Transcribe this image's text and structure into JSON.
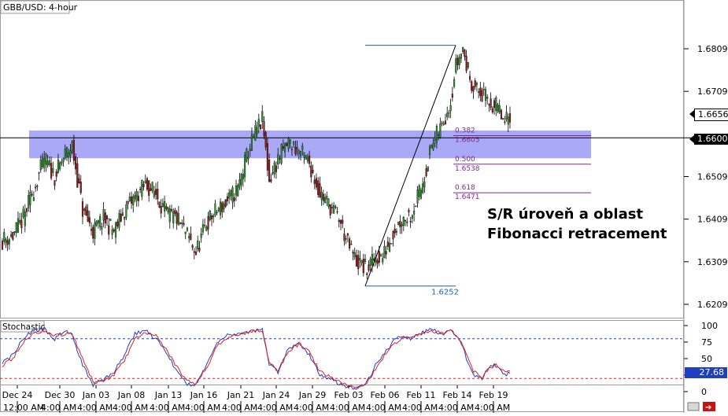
{
  "window_title": "GBB/USD: 4-hour",
  "indicator_title": "Stochastic",
  "colors": {
    "candle_up": "#2e8b2e",
    "candle_down": "#8b1a1a",
    "zone_fill": "#8c8cf5",
    "fib_line": "#7a2a8a",
    "fib_text": "#7a2a8a",
    "swing_line": "#1f5fbf",
    "stoch_k": "#1f3fbf",
    "stoch_d": "#e02020",
    "stoch_level_high": "#1f3fbf",
    "stoch_level_low": "#e02020",
    "current_price_bg": "#000000",
    "last_price_bg": "#ffffff",
    "stoch_badge_bg": "#1f3fbf"
  },
  "annotation": {
    "line1": "S/R úroveň a oblast",
    "line2": "Fibonacci retracement"
  },
  "chart_data": [
    {
      "type": "candlestick",
      "title": "GBB/USD: 4-hour",
      "ylim": [
        1.6185,
        1.6905
      ],
      "y_ticks": [
        "1.6809",
        "1.6709",
        "1.6509",
        "1.6409",
        "1.6309",
        "1.6209"
      ],
      "y_tick_values": [
        1.6809,
        1.6709,
        1.6509,
        1.6409,
        1.6309,
        1.6209
      ],
      "last_price": "1.6656",
      "current_level_label": "1.6600",
      "sr_level": 1.66,
      "sr_zone": [
        1.6552,
        1.6617
      ],
      "swing_low_label": "1.6252",
      "swing_low": 1.6252,
      "swing_high": 1.6817,
      "fibonacci": [
        {
          "ratio": "0.382",
          "price": "1.6605",
          "value": 1.6605
        },
        {
          "ratio": "0.500",
          "price": "1.6538",
          "value": 1.6538
        },
        {
          "ratio": "0.618",
          "price": "1.6471",
          "value": 1.6471
        }
      ],
      "close_path": [
        [
          0,
          1.636
        ],
        [
          6,
          1.637
        ],
        [
          12,
          1.641
        ],
        [
          18,
          1.648
        ],
        [
          24,
          1.655
        ],
        [
          30,
          1.651
        ],
        [
          36,
          1.656
        ],
        [
          40,
          1.658
        ],
        [
          46,
          1.643
        ],
        [
          52,
          1.638
        ],
        [
          58,
          1.641
        ],
        [
          64,
          1.638
        ],
        [
          70,
          1.643
        ],
        [
          76,
          1.646
        ],
        [
          82,
          1.649
        ],
        [
          88,
          1.647
        ],
        [
          94,
          1.642
        ],
        [
          100,
          1.641
        ],
        [
          106,
          1.637
        ],
        [
          111,
          1.633
        ],
        [
          117,
          1.64
        ],
        [
          123,
          1.643
        ],
        [
          129,
          1.645
        ],
        [
          135,
          1.648
        ],
        [
          141,
          1.657
        ],
        [
          146,
          1.662
        ],
        [
          149,
          1.664
        ],
        [
          153,
          1.65
        ],
        [
          158,
          1.655
        ],
        [
          164,
          1.659
        ],
        [
          170,
          1.657
        ],
        [
          176,
          1.654
        ],
        [
          182,
          1.647
        ],
        [
          188,
          1.644
        ],
        [
          193,
          1.641
        ],
        [
          198,
          1.635
        ],
        [
          203,
          1.631
        ],
        [
          209,
          1.629
        ],
        [
          214,
          1.632
        ],
        [
          218,
          1.632
        ],
        [
          224,
          1.638
        ],
        [
          229,
          1.641
        ],
        [
          234,
          1.642
        ],
        [
          240,
          1.648
        ],
        [
          246,
          1.658
        ],
        [
          252,
          1.663
        ],
        [
          257,
          1.669
        ],
        [
          260,
          1.677
        ],
        [
          264,
          1.681
        ],
        [
          266,
          1.677
        ],
        [
          270,
          1.672
        ],
        [
          275,
          1.67
        ],
        [
          280,
          1.668
        ],
        [
          284,
          1.667
        ],
        [
          288,
          1.663
        ],
        [
          291,
          1.6656
        ]
      ],
      "x_tick_labels": [
        "Dec 24",
        "Dec 30",
        "Jan 03",
        "Jan 08",
        "Jan 13",
        "Jan 16",
        "Jan 21",
        "Jan 24",
        "Jan 29",
        "Feb 03",
        "Feb 06",
        "Feb 11",
        "Feb 14",
        "Feb 19"
      ],
      "x_tick_times": [
        "12:00 AM",
        "4:00 AM",
        "4:00 AM",
        "4:00 AM",
        "4:00 AM",
        "4:00 AM",
        "4:00 AM",
        "4:00 AM",
        "4:00 AM",
        "4:00 AM",
        "4:00 AM",
        "4:00 AM",
        "4:00 AM",
        "4:00 AM"
      ]
    },
    {
      "type": "line",
      "title": "Stochastic",
      "ylim": [
        0,
        100
      ],
      "y_ticks": [
        "100",
        "75",
        "50",
        "25",
        "0"
      ],
      "y_tick_values": [
        100,
        75,
        50,
        25,
        0
      ],
      "levels": [
        80,
        20
      ],
      "current_value_label": "27.68",
      "series": [
        {
          "values": [
            [
              0,
              45
            ],
            [
              6,
              55
            ],
            [
              12,
              82
            ],
            [
              18,
              92
            ],
            [
              24,
              95
            ],
            [
              30,
              80
            ],
            [
              36,
              92
            ],
            [
              40,
              85
            ],
            [
              46,
              40
            ],
            [
              52,
              10
            ],
            [
              58,
              18
            ],
            [
              64,
              30
            ],
            [
              70,
              55
            ],
            [
              76,
              88
            ],
            [
              82,
              92
            ],
            [
              88,
              80
            ],
            [
              94,
              60
            ],
            [
              100,
              30
            ],
            [
              106,
              12
            ],
            [
              111,
              10
            ],
            [
              117,
              40
            ],
            [
              123,
              75
            ],
            [
              129,
              85
            ],
            [
              135,
              88
            ],
            [
              141,
              90
            ],
            [
              146,
              94
            ],
            [
              149,
              95
            ],
            [
              153,
              40
            ],
            [
              158,
              30
            ],
            [
              164,
              65
            ],
            [
              170,
              75
            ],
            [
              176,
              55
            ],
            [
              182,
              25
            ],
            [
              188,
              20
            ],
            [
              193,
              12
            ],
            [
              198,
              8
            ],
            [
              203,
              4
            ],
            [
              209,
              15
            ],
            [
              214,
              40
            ],
            [
              218,
              55
            ],
            [
              224,
              75
            ],
            [
              229,
              85
            ],
            [
              234,
              80
            ],
            [
              240,
              88
            ],
            [
              246,
              96
            ],
            [
              252,
              85
            ],
            [
              257,
              96
            ],
            [
              260,
              85
            ],
            [
              264,
              70
            ],
            [
              266,
              50
            ],
            [
              270,
              25
            ],
            [
              275,
              20
            ],
            [
              280,
              42
            ],
            [
              284,
              38
            ],
            [
              288,
              25
            ],
            [
              291,
              27.68
            ]
          ]
        },
        {
          "values": [
            [
              0,
              40
            ],
            [
              6,
              50
            ],
            [
              12,
              75
            ],
            [
              18,
              88
            ],
            [
              24,
              92
            ],
            [
              30,
              85
            ],
            [
              36,
              88
            ],
            [
              40,
              88
            ],
            [
              46,
              50
            ],
            [
              52,
              15
            ],
            [
              58,
              15
            ],
            [
              64,
              25
            ],
            [
              70,
              48
            ],
            [
              76,
              80
            ],
            [
              82,
              90
            ],
            [
              88,
              85
            ],
            [
              94,
              65
            ],
            [
              100,
              38
            ],
            [
              106,
              15
            ],
            [
              111,
              12
            ],
            [
              117,
              35
            ],
            [
              123,
              68
            ],
            [
              129,
              82
            ],
            [
              135,
              87
            ],
            [
              141,
              89
            ],
            [
              146,
              92
            ],
            [
              149,
              93
            ],
            [
              153,
              45
            ],
            [
              158,
              32
            ],
            [
              164,
              60
            ],
            [
              170,
              72
            ],
            [
              176,
              60
            ],
            [
              182,
              30
            ],
            [
              188,
              22
            ],
            [
              193,
              15
            ],
            [
              198,
              10
            ],
            [
              203,
              6
            ],
            [
              209,
              12
            ],
            [
              214,
              35
            ],
            [
              218,
              50
            ],
            [
              224,
              70
            ],
            [
              229,
              82
            ],
            [
              234,
              82
            ],
            [
              240,
              86
            ],
            [
              246,
              92
            ],
            [
              252,
              88
            ],
            [
              257,
              92
            ],
            [
              260,
              86
            ],
            [
              264,
              72
            ],
            [
              266,
              55
            ],
            [
              270,
              30
            ],
            [
              275,
              22
            ],
            [
              280,
              38
            ],
            [
              284,
              40
            ],
            [
              288,
              28
            ],
            [
              291,
              30
            ]
          ]
        }
      ]
    }
  ]
}
